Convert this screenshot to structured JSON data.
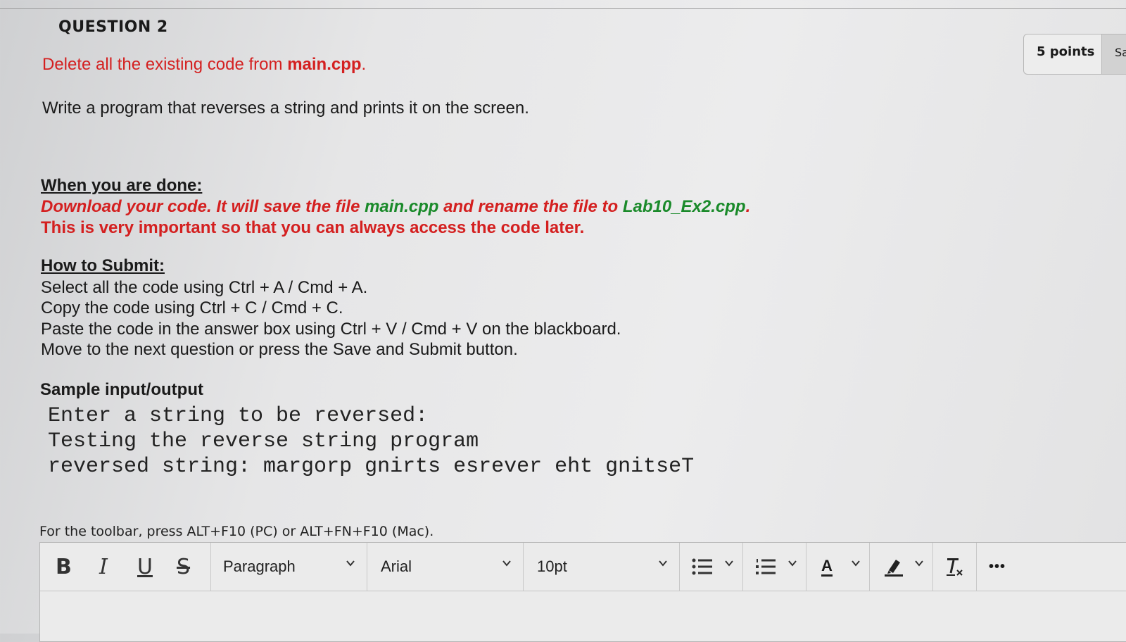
{
  "question": {
    "title": "QUESTION 2",
    "points": "5 points",
    "save_label": "Sa"
  },
  "instructions": {
    "delete_prefix": "Delete all the existing code from ",
    "delete_file": "main.cpp",
    "delete_suffix": ".",
    "task": "Write a program that reverses a string and prints it on the screen.",
    "when_done_heading": "When you are done:",
    "download_part1": "Download your code. It will save the file ",
    "download_file": "main.cpp",
    "download_part2": " and rename the file to ",
    "download_newname": "Lab10_Ex2.cpp",
    "download_end": ".",
    "important": "This is very important so that you can always access the code later.",
    "submit_heading": "How to Submit:",
    "submit_steps": [
      "Select all the code using Ctrl + A / Cmd + A.",
      "Copy the code using Ctrl + C / Cmd + C.",
      "Paste the code in the answer box using Ctrl + V / Cmd + V on the blackboard.",
      "Move to the next question or press the Save and Submit button."
    ],
    "sample_heading": "Sample input/output",
    "sample_lines": [
      "Enter a string to be reversed:",
      "Testing the reverse string program",
      "reversed string: margorp gnirts esrever eht gnitseT"
    ]
  },
  "editor": {
    "toolbar_hint": "For the toolbar, press ALT+F10 (PC) or ALT+FN+F10 (Mac).",
    "bold": "B",
    "italic": "I",
    "underline": "U",
    "strike": "S",
    "paragraph": "Paragraph",
    "font": "Arial",
    "size": "10pt",
    "font_color": "A",
    "more": "•••"
  },
  "colors": {
    "red": "#d42020",
    "green": "#1a8a2a"
  }
}
